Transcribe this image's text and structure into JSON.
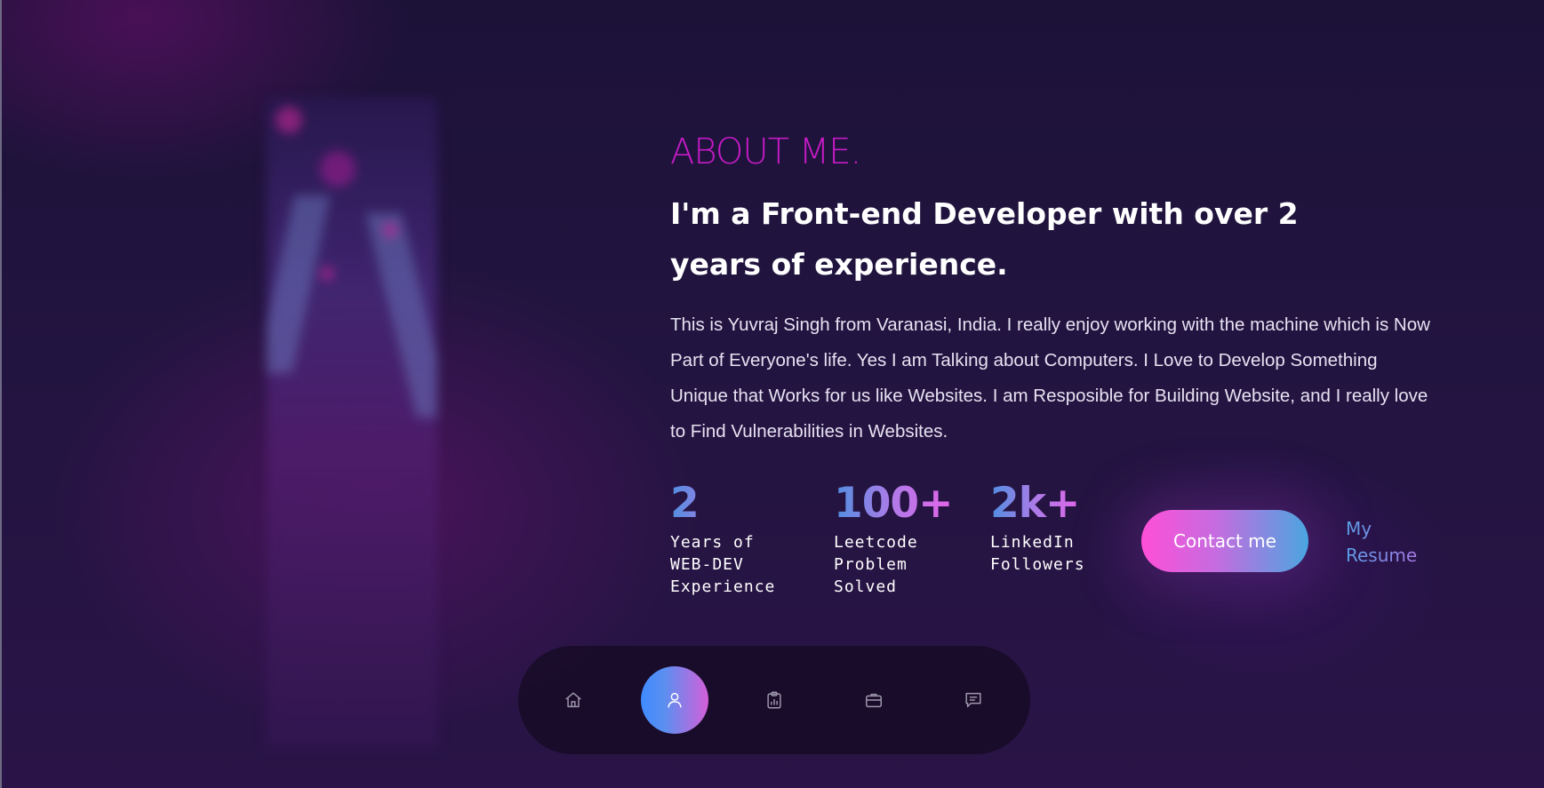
{
  "about": {
    "section_title": "ABOUT ME.",
    "headline": "I'm a Front-end Developer with over 2 years of experience.",
    "bio": "This is Yuvraj Singh from Varanasi, India. I really enjoy working with the machine which is Now Part of Everyone's life. Yes I am Talking about Computers. I Love to Develop Something Unique that Works for us like Websites. I am Resposible for Building Website, and I really love to Find Vulnerabilities in Websites."
  },
  "stats": [
    {
      "number": "2",
      "label": "Years of\nWEB-DEV\nExperience"
    },
    {
      "number": "100+",
      "label": "Leetcode\nProblem\nSolved"
    },
    {
      "number": "2k+",
      "label": "LinkedIn\nFollowers"
    }
  ],
  "actions": {
    "contact_label": "Contact me",
    "resume_label": "My Resume"
  },
  "nav": {
    "items": [
      {
        "icon": "home-icon",
        "active": false
      },
      {
        "icon": "user-icon",
        "active": true
      },
      {
        "icon": "clipboard-chart-icon",
        "active": false
      },
      {
        "icon": "briefcase-icon",
        "active": false
      },
      {
        "icon": "chat-icon",
        "active": false
      }
    ]
  },
  "colors": {
    "accent_magenta": "#c51bc5",
    "gradient_pink": "#ff4fd8",
    "gradient_blue": "#4aa6e0",
    "background": "#221440"
  }
}
